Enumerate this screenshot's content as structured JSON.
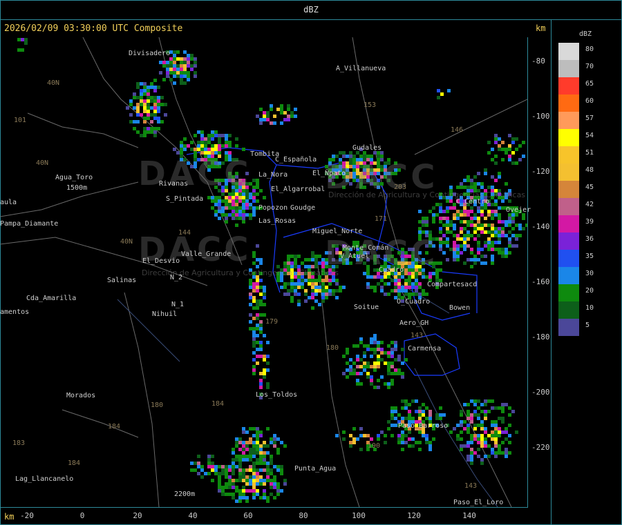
{
  "header": {
    "title": "dBZ"
  },
  "map_info": {
    "composite": "2026/02/09 03:30:00 UTC Composite",
    "unit": "km"
  },
  "legend": {
    "title": "dBZ",
    "levels": [
      {
        "value": "80",
        "color": "#d9d9d9"
      },
      {
        "value": "70",
        "color": "#bdbdbd"
      },
      {
        "value": "65",
        "color": "#ff3b2b"
      },
      {
        "value": "60",
        "color": "#ff6a12"
      },
      {
        "value": "57",
        "color": "#ff9a5a"
      },
      {
        "value": "54",
        "color": "#ffff00"
      },
      {
        "value": "51",
        "color": "#f7c42a"
      },
      {
        "value": "48",
        "color": "#f4c030"
      },
      {
        "value": "45",
        "color": "#d5853a"
      },
      {
        "value": "42",
        "color": "#c0608a"
      },
      {
        "value": "39",
        "color": "#d318a4"
      },
      {
        "value": "36",
        "color": "#7a22d8"
      },
      {
        "value": "35",
        "color": "#2050f0"
      },
      {
        "value": "30",
        "color": "#1a86e8"
      },
      {
        "value": "20",
        "color": "#0e8a0e"
      },
      {
        "value": "10",
        "color": "#0d5f1a"
      },
      {
        "value": "5",
        "color": "#4b4799"
      }
    ]
  },
  "y_axis": [
    "-80",
    "-100",
    "-120",
    "-140",
    "-160",
    "-180",
    "-200",
    "-220"
  ],
  "x_axis": [
    "-20",
    "0",
    "20",
    "40",
    "60",
    "80",
    "100",
    "120",
    "140"
  ],
  "places": [
    "Divisadero",
    "A_Villanueva",
    "Tombita",
    "C_Española",
    "Gudales",
    "El_Ñpato",
    "La_Nora",
    "Rivanas",
    "El_Algarrobal",
    "Agua_Toro",
    "Pampa_Diamante",
    "S_Pintada",
    "Popozon",
    "Goudge",
    "Las_Rosas",
    "Miguel_Norte",
    "Valle_Grande",
    "El_Desvio",
    "Salinas",
    "N_2",
    "N_1",
    "Nihuil",
    "Cda_Amarilla",
    "amentos",
    "Monte_Comán",
    "V_Atuel",
    "Soitue",
    "Compartesacd",
    "Cuadro",
    "O_Cuadro",
    "Bowen",
    "Aero_GH",
    "Carmensa",
    "Morados",
    "Los_Toldos",
    "Paso_Barroso",
    "Punta_Agua",
    "Lag_Llancanelo",
    "Paso_El_Loro",
    "aula",
    "Ovejer",
    "C_Centro",
    "1500m",
    "2200m"
  ],
  "roads": [
    "40N",
    "101",
    "40N",
    "153",
    "146",
    "171",
    "144",
    "179",
    "180",
    "184",
    "184",
    "183",
    "180",
    "184",
    "190",
    "143",
    "143",
    "40N",
    "203"
  ],
  "watermark": {
    "brand": "DACC",
    "subtitle": "Dirección de Agricultura y Contingencias Climáticas"
  }
}
